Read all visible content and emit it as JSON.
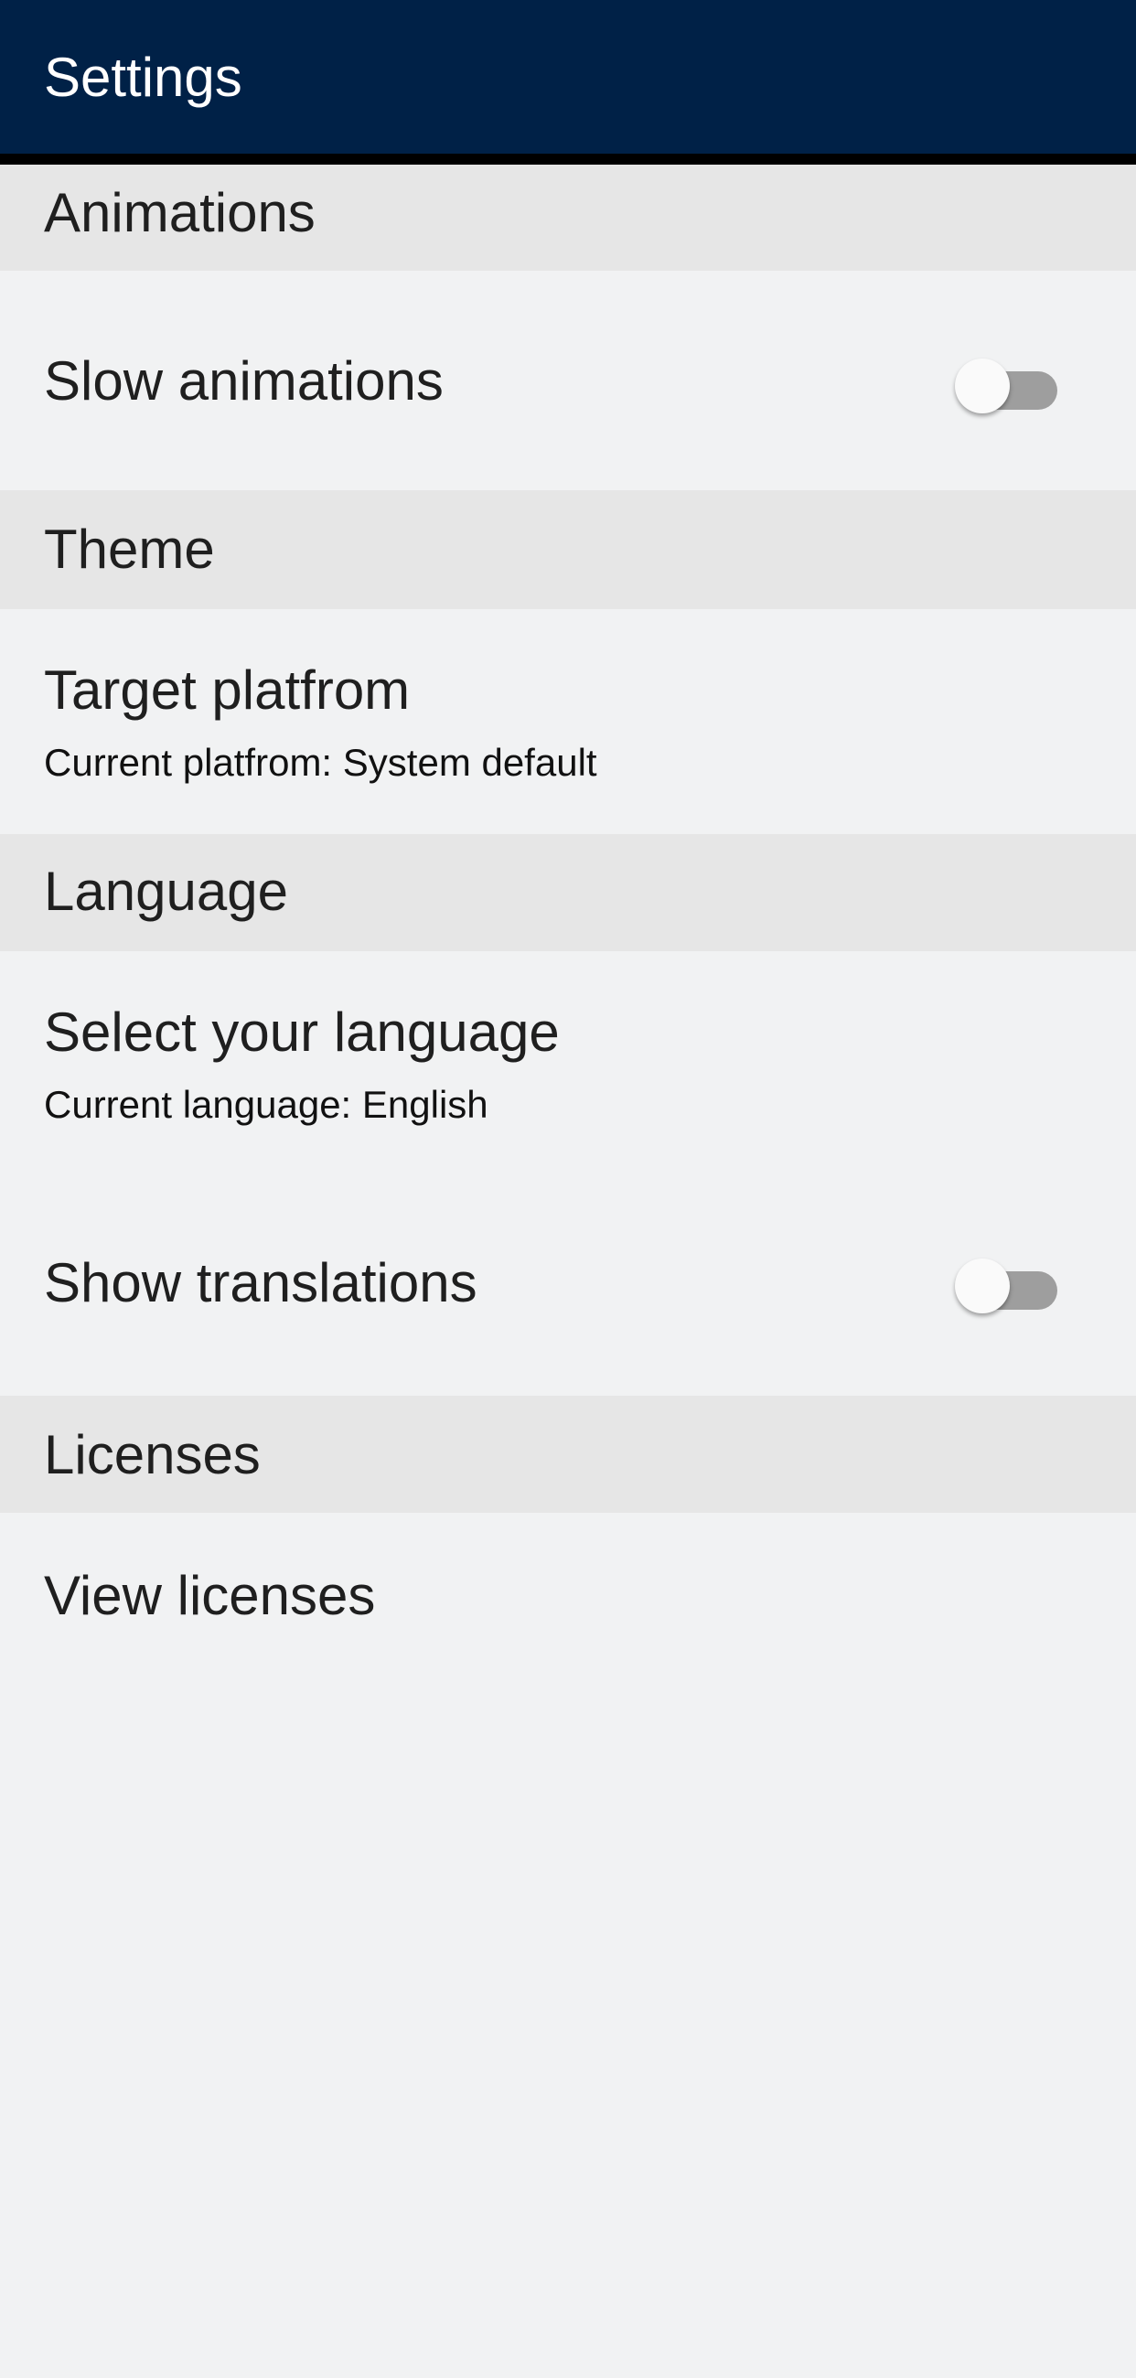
{
  "appbar": {
    "title": "Settings"
  },
  "sections": {
    "animations": {
      "header": "Animations",
      "slow_animations": {
        "label": "Slow animations",
        "enabled": false
      }
    },
    "theme": {
      "header": "Theme",
      "target_platform": {
        "label": "Target platfrom",
        "subtitle": "Current platfrom: System default"
      }
    },
    "language": {
      "header": "Language",
      "select_language": {
        "label": "Select your language",
        "subtitle": "Current language: English"
      },
      "show_translations": {
        "label": "Show translations",
        "enabled": false
      }
    },
    "licenses": {
      "header": "Licenses",
      "view_licenses": {
        "label": "View licenses"
      }
    }
  },
  "colors": {
    "appbar": "#002147",
    "section_header_bg": "#e6e6e6",
    "page_bg": "#f1f2f3",
    "switch_track_off": "#9e9e9e"
  }
}
